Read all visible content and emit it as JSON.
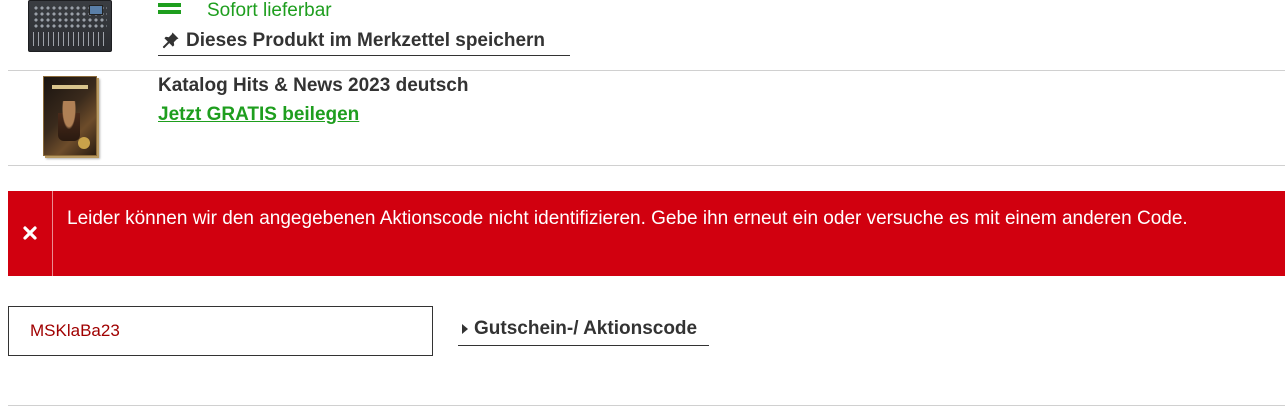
{
  "product": {
    "image_icon": "mixer-product-image",
    "stock_icon": "availability-bars-icon",
    "stock_text": "Sofort lieferbar",
    "wishlist_icon": "pushpin-icon",
    "wishlist_label": "Dieses Produkt im Merkzettel speichern"
  },
  "catalog": {
    "image_icon": "catalog-cover-image",
    "title": "Katalog Hits & News 2023 deutsch",
    "link_label": "Jetzt GRATIS beilegen"
  },
  "error": {
    "icon": "close-icon",
    "message": "Leider können wir den angegebenen Aktionscode nicht identifizieren. Gebe ihn erneut ein oder versuche es mit einem anderen Code."
  },
  "coupon": {
    "input_value": "MSKlaBa23",
    "button_icon": "caret-right-icon",
    "button_label": "Gutschein-/ Aktionscode"
  },
  "colors": {
    "success_green": "#1e9e1e",
    "error_red": "#d1000f",
    "input_text": "#a00000",
    "text_dark": "#333333"
  }
}
